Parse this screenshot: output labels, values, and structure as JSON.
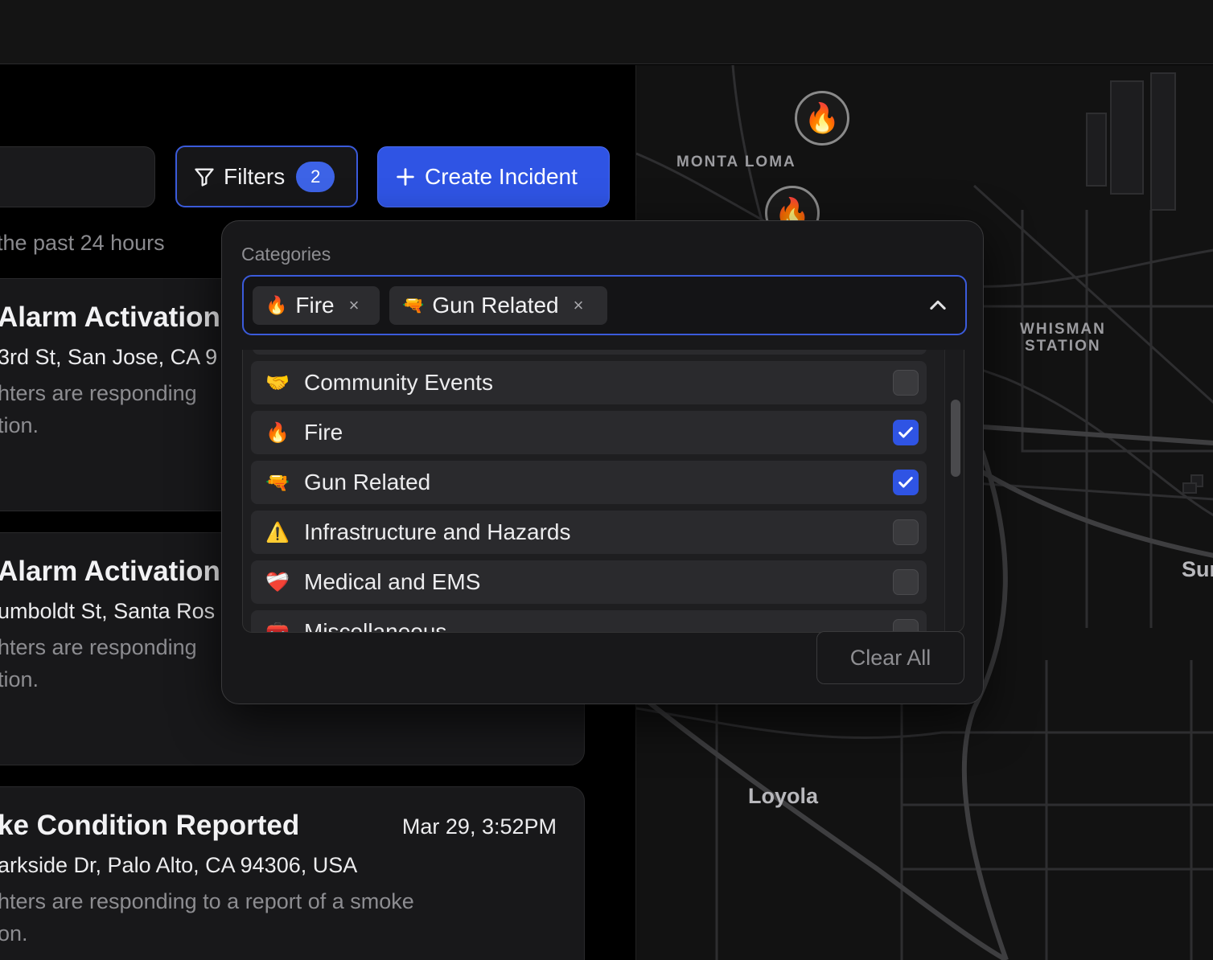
{
  "toolbar": {
    "filters_label": "Filters",
    "filters_count": "2",
    "create_label": "Create Incident"
  },
  "feed": {
    "recent_text": "the past 24 hours",
    "cards": [
      {
        "title": "Alarm Activation",
        "address": "3rd St, San Jose, CA 9",
        "desc1": "hters are responding",
        "desc2": "tion."
      },
      {
        "title": "Alarm Activation",
        "address": "umboldt St, Santa Ros",
        "desc1": "hters are responding",
        "desc2": "tion."
      },
      {
        "title": "ke Condition Reported",
        "date": "Mar 29, 3:52PM",
        "address": "arkside Dr, Palo Alto, CA 94306, USA",
        "desc1": "hters are responding to a report of a smoke",
        "desc2": "on."
      }
    ]
  },
  "filter_popover": {
    "categories_label": "Categories",
    "selected_chips": [
      {
        "emoji": "🔥",
        "label": "Fire",
        "remove": "×"
      },
      {
        "emoji": "🔫",
        "label": "Gun Related",
        "remove": "×"
      }
    ],
    "options": [
      {
        "emoji": "🤝",
        "label": "Community Events",
        "checked": false
      },
      {
        "emoji": "🔥",
        "label": "Fire",
        "checked": true
      },
      {
        "emoji": "🔫",
        "label": "Gun Related",
        "checked": true
      },
      {
        "emoji": "⚠️",
        "label": "Infrastructure and Hazards",
        "checked": false
      },
      {
        "emoji": "❤️‍🩹",
        "label": "Medical and EMS",
        "checked": false
      },
      {
        "emoji": "🧰",
        "label": "Miscellaneous",
        "checked": false
      }
    ],
    "clear_all_label": "Clear All"
  },
  "map": {
    "labels": [
      "MONTA LOMA",
      "WHISMAN",
      "STATION",
      "Loyola",
      "Sur"
    ],
    "marker_icon": "🔥"
  },
  "colors": {
    "accent": "#2f54e4",
    "focus_border": "#3b5bdb",
    "background": "#000000",
    "panel": "#18181a"
  }
}
